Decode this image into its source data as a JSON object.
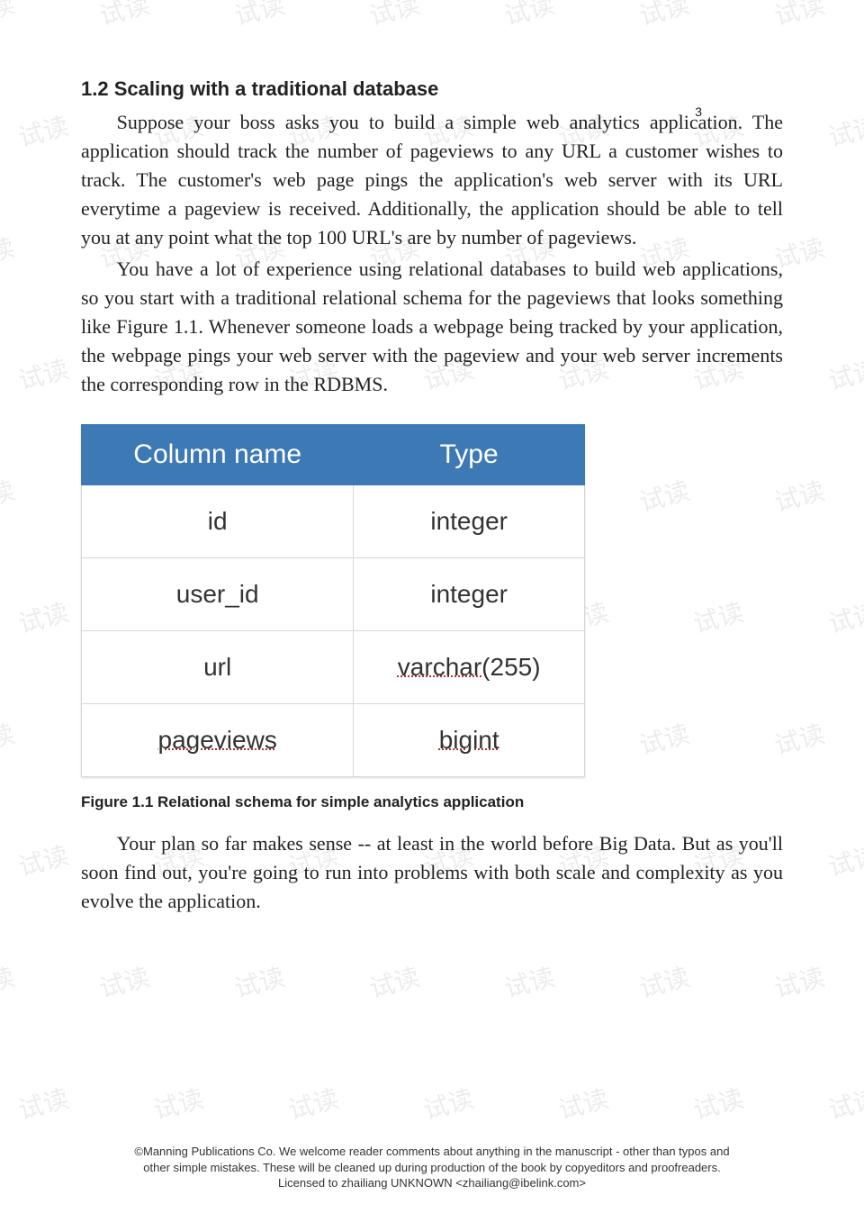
{
  "page_number": "3",
  "section": {
    "number": "1.2",
    "title": " Scaling with a traditional database"
  },
  "body": {
    "p1": "Suppose your boss asks you to build a simple web analytics application. The application should track the number of pageviews to any URL a customer wishes to track. The customer's web page pings the application's web server with its URL everytime a pageview is received. Additionally, the application should be able to tell you at any point what the top 100 URL's are by number of pageviews.",
    "p2": "You have a lot of experience using relational databases to build web applications, so you start with a traditional relational schema for the pageviews that looks something like Figure 1.1. Whenever someone loads a webpage being tracked by your application, the webpage pings your web server with the pageview and your web server increments the corresponding row in the RDBMS.",
    "p3": "Your plan so far makes sense -- at least in the world before Big Data. But as you'll soon find out, you're going to run into problems with both scale and complexity as you evolve the application."
  },
  "chart_data": {
    "type": "table",
    "title": "Relational schema for simple analytics application",
    "columns": [
      "Column name",
      "Type"
    ],
    "rows": [
      {
        "name": "id",
        "type": "integer",
        "name_underlined": false,
        "type_underlined": false
      },
      {
        "name": "user_id",
        "type": "integer",
        "name_underlined": false,
        "type_underlined": false
      },
      {
        "name": "url",
        "type": "varchar(255)",
        "name_underlined": false,
        "type_underlined": true,
        "type_raw": "varchar",
        "type_suffix": "(255)"
      },
      {
        "name": "pageviews",
        "type": "bigint",
        "name_underlined": true,
        "type_underlined": true
      }
    ]
  },
  "figure_caption": "Figure 1.1 Relational schema for simple analytics application",
  "footer": {
    "line1": "©Manning Publications Co. We welcome reader comments about anything in the manuscript - other than typos and",
    "line2": "other simple mistakes. These will be cleaned up during production of the book by copyeditors and proofreaders.",
    "line3": "Licensed to zhailiang UNKNOWN <zhailiang@ibelink.com>"
  },
  "watermark": {
    "text": "试读"
  }
}
